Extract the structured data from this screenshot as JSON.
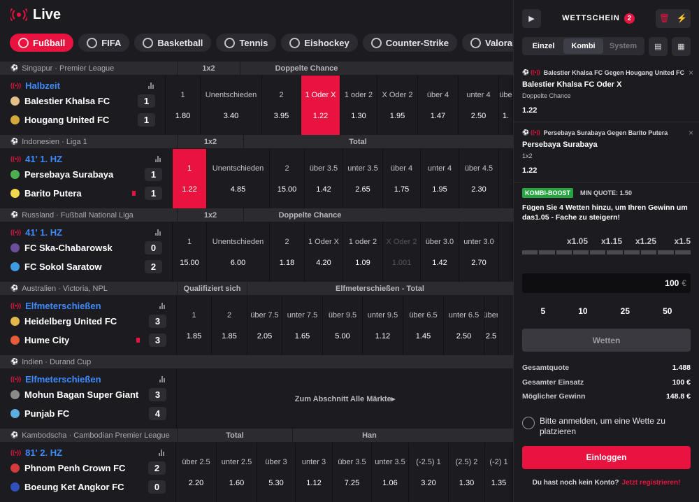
{
  "header": {
    "title": "Live"
  },
  "sports": [
    {
      "label": "Fußball",
      "icon": "soccer-ball-icon",
      "active": true
    },
    {
      "label": "FIFA",
      "icon": "fifa-icon"
    },
    {
      "label": "Basketball",
      "icon": "basketball-icon"
    },
    {
      "label": "Tennis",
      "icon": "tennis-icon"
    },
    {
      "label": "Eishockey",
      "icon": "hockey-icon"
    },
    {
      "label": "Counter-Strike",
      "icon": "counter-strike-icon"
    },
    {
      "label": "Valorant",
      "icon": "valorant-icon"
    }
  ],
  "groups": [
    {
      "league": "Singapur · Premier League",
      "markets": [
        "1x2",
        "Doppelte Chance"
      ],
      "status": "Halbzeit",
      "teams": [
        {
          "name": "Balestier Khalsa FC",
          "score": "1"
        },
        {
          "name": "Hougang United FC",
          "score": "1"
        }
      ],
      "odds": [
        {
          "l": "1",
          "v": "1.80"
        },
        {
          "l": "Unentschieden",
          "v": "3.40"
        },
        {
          "l": "2",
          "v": "3.95"
        },
        {
          "l": "1 Oder X",
          "v": "1.22",
          "sel": true
        },
        {
          "l": "1 oder 2",
          "v": "1.30"
        },
        {
          "l": "X Oder 2",
          "v": "1.95"
        },
        {
          "l": "über 4",
          "v": "1.47"
        },
        {
          "l": "unter 4",
          "v": "2.50"
        },
        {
          "l": "übe",
          "v": "1."
        }
      ]
    },
    {
      "league": "Indonesien · Liga 1",
      "markets": [
        "1x2",
        "Total"
      ],
      "status": "41' 1. HZ",
      "teams": [
        {
          "name": "Persebaya Surabaya",
          "score": "1"
        },
        {
          "name": "Barito Putera",
          "score": "1",
          "red": true
        }
      ],
      "odds": [
        {
          "l": "1",
          "v": "1.22",
          "sel": true
        },
        {
          "l": "Unentschieden",
          "v": "4.85"
        },
        {
          "l": "2",
          "v": "15.00"
        },
        {
          "l": "über 3.5",
          "v": "1.42"
        },
        {
          "l": "unter 3.5",
          "v": "2.65"
        },
        {
          "l": "über 4",
          "v": "1.75"
        },
        {
          "l": "unter 4",
          "v": "1.95"
        },
        {
          "l": "über 4.5",
          "v": "2.30"
        },
        {
          "l": "",
          "v": ""
        }
      ]
    },
    {
      "league": "Russland · Fußball National Liga",
      "markets": [
        "1x2",
        "Doppelte Chance"
      ],
      "status": "41' 1. HZ",
      "teams": [
        {
          "name": "FC Ska-Chabarowsk",
          "score": "0"
        },
        {
          "name": "FC Sokol Saratow",
          "score": "2"
        }
      ],
      "odds": [
        {
          "l": "1",
          "v": "15.00"
        },
        {
          "l": "Unentschieden",
          "v": "6.00"
        },
        {
          "l": "2",
          "v": "1.18"
        },
        {
          "l": "1 Oder X",
          "v": "4.20"
        },
        {
          "l": "1 oder 2",
          "v": "1.09"
        },
        {
          "l": "X Oder 2",
          "v": "1.001",
          "dim": true
        },
        {
          "l": "über 3.0",
          "v": "1.42"
        },
        {
          "l": "unter 3.0",
          "v": "2.70"
        },
        {
          "l": "",
          "v": ""
        }
      ]
    },
    {
      "league": "Australien · Victoria, NPL",
      "markets": [
        "Qualifiziert sich",
        "Elfmeterschießen - Total"
      ],
      "status": "Elfmeterschießen",
      "teams": [
        {
          "name": "Heidelberg United FC",
          "score": "3"
        },
        {
          "name": "Hume City",
          "score": "3",
          "red": true
        }
      ],
      "odds": [
        {
          "l": "1",
          "v": "1.85"
        },
        {
          "l": "2",
          "v": "1.85"
        },
        {
          "l": "über 7.5",
          "v": "2.05"
        },
        {
          "l": "unter 7.5",
          "v": "1.65"
        },
        {
          "l": "über 9.5",
          "v": "5.00"
        },
        {
          "l": "unter 9.5",
          "v": "1.12"
        },
        {
          "l": "über 6.5",
          "v": "1.45"
        },
        {
          "l": "unter 6.5",
          "v": "2.50"
        },
        {
          "l": "über",
          "v": "2.5"
        }
      ]
    },
    {
      "league": "Indien · Durand Cup",
      "markets": [],
      "status": "Elfmeterschießen",
      "teams": [
        {
          "name": "Mohun Bagan Super Giant",
          "score": "3"
        },
        {
          "name": "Punjab FC",
          "score": "4"
        }
      ],
      "all_markets": "Zum Abschnitt Alle Märkte"
    },
    {
      "league": "Kambodscha · Cambodian Premier League",
      "markets": [
        "Total",
        "Han"
      ],
      "status": "81' 2. HZ",
      "teams": [
        {
          "name": "Phnom Penh Crown FC",
          "score": "2"
        },
        {
          "name": "Boeung Ket Angkor FC",
          "score": "0"
        }
      ],
      "odds": [
        {
          "l": "über 2.5",
          "v": "2.20"
        },
        {
          "l": "unter 2.5",
          "v": "1.60"
        },
        {
          "l": "über 3",
          "v": "5.30"
        },
        {
          "l": "unter 3",
          "v": "1.12"
        },
        {
          "l": "über 3.5",
          "v": "7.25"
        },
        {
          "l": "unter 3.5",
          "v": "1.06"
        },
        {
          "l": "(-2.5) 1",
          "v": "3.20"
        },
        {
          "l": "(2.5) 2",
          "v": "1.30"
        },
        {
          "l": "(-2) 1",
          "v": "1.35"
        }
      ]
    }
  ],
  "betslip": {
    "title": "WETTSCHEIN",
    "count": "2",
    "modes": [
      "Einzel",
      "Kombi",
      "System"
    ],
    "bets": [
      {
        "match": "Balestier Khalsa FC Gegen Hougang United FC",
        "pick": "Balestier Khalsa FC Oder X",
        "type": "Doppelte Chance",
        "odd": "1.22"
      },
      {
        "match": "Persebaya Surabaya Gegen Barito Putera",
        "pick": "Persebaya Surabaya",
        "type": "1x2",
        "odd": "1.22"
      }
    ],
    "boost_badge": "KOMBI-BOOST",
    "min_quote": "MIN QUOTE: 1.50",
    "boost_text": "Fügen Sie 4 Wetten hinzu, um Ihren Gewinn um das1.05 - Fache zu steigern!",
    "multipliers": [
      "x1.05",
      "x1.15",
      "x1.25",
      "x1.5"
    ],
    "stake": "100",
    "currency": "€",
    "quick": [
      "5",
      "10",
      "25",
      "50"
    ],
    "bet_button": "Wetten",
    "summary": [
      {
        "k": "Gesamtquote",
        "v": "1.488"
      },
      {
        "k": "Gesamter Einsatz",
        "v": "100 €"
      },
      {
        "k": "Möglicher Gewinn",
        "v": "148.8 €"
      }
    ],
    "login_hint": "Bitte anmelden, um eine Wette zu platzieren",
    "login_button": "Einloggen",
    "no_account": "Du hast noch kein Konto?",
    "register": "Jetzt registrieren!"
  }
}
